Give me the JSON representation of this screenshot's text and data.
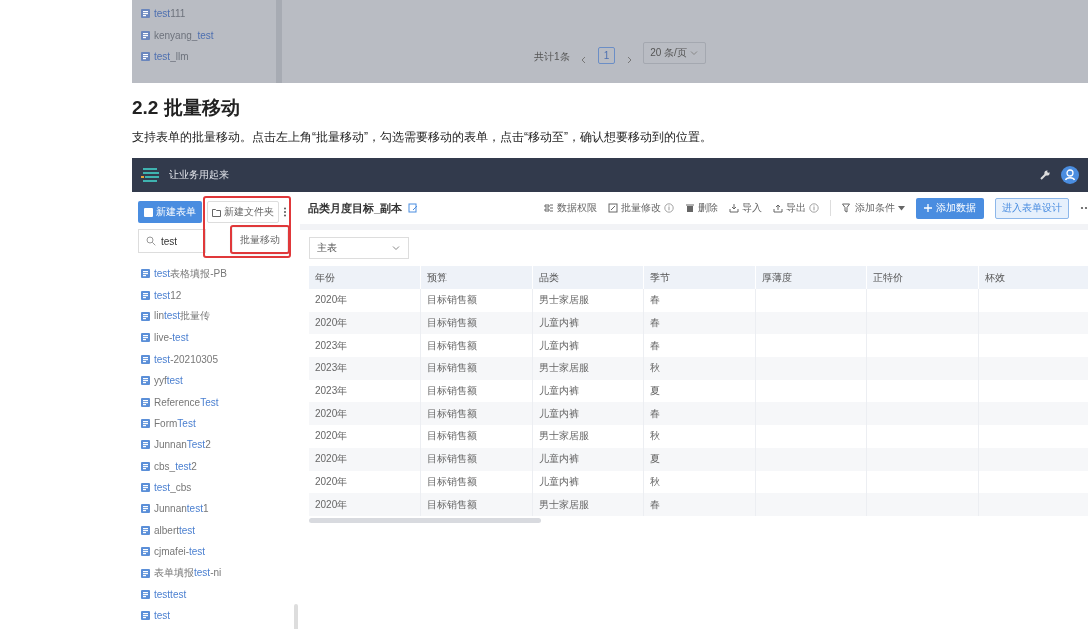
{
  "prior_screenshot": {
    "sidebar_items": [
      {
        "parts": [
          {
            "text": "test",
            "match": true
          },
          {
            "text": "111",
            "match": false
          }
        ]
      },
      {
        "parts": [
          {
            "text": "kenyang_",
            "match": false
          },
          {
            "text": "test",
            "match": true
          }
        ]
      },
      {
        "parts": [
          {
            "text": "test",
            "match": true
          },
          {
            "text": "_llm",
            "match": false
          }
        ]
      }
    ],
    "pagination": {
      "total": "共计1条",
      "page": "1",
      "page_size": "20 条/页"
    }
  },
  "section": {
    "heading": "2.2 批量移动",
    "body": "支持表单的批量移动。点击左上角“批量移动”，勾选需要移动的表单，点击“移动至”，确认想要移动到的位置。"
  },
  "app": {
    "brand": "让业务用起来",
    "sidebar": {
      "new_form": "新建表单",
      "new_folder": "新建文件夹",
      "menu": [
        "批量移动"
      ],
      "search": {
        "value": "test"
      },
      "items": [
        {
          "parts": [
            {
              "text": "test",
              "match": true
            },
            {
              "text": "表格填报-PB",
              "match": false
            }
          ]
        },
        {
          "parts": [
            {
              "text": "test",
              "match": true
            },
            {
              "text": "12",
              "match": false
            }
          ]
        },
        {
          "parts": [
            {
              "text": "lin",
              "match": false
            },
            {
              "text": "test",
              "match": true
            },
            {
              "text": "批量传",
              "match": false
            }
          ]
        },
        {
          "parts": [
            {
              "text": "live-",
              "match": false
            },
            {
              "text": "test",
              "match": true
            }
          ]
        },
        {
          "parts": [
            {
              "text": "test",
              "match": true
            },
            {
              "text": "-20210305",
              "match": false
            }
          ]
        },
        {
          "parts": [
            {
              "text": "yyf",
              "match": false
            },
            {
              "text": "test",
              "match": true
            }
          ]
        },
        {
          "parts": [
            {
              "text": "Reference",
              "match": false
            },
            {
              "text": "Test",
              "match": true
            }
          ]
        },
        {
          "parts": [
            {
              "text": "Form",
              "match": false
            },
            {
              "text": "Test",
              "match": true
            }
          ]
        },
        {
          "parts": [
            {
              "text": "Junnan",
              "match": false
            },
            {
              "text": "Test",
              "match": true
            },
            {
              "text": "2",
              "match": false
            }
          ]
        },
        {
          "parts": [
            {
              "text": "cbs_",
              "match": false
            },
            {
              "text": "test",
              "match": true
            },
            {
              "text": "2",
              "match": false
            }
          ]
        },
        {
          "parts": [
            {
              "text": "test",
              "match": true
            },
            {
              "text": "_cbs",
              "match": false
            }
          ]
        },
        {
          "parts": [
            {
              "text": "Junnan",
              "match": false
            },
            {
              "text": "test",
              "match": true
            },
            {
              "text": "1",
              "match": false
            }
          ]
        },
        {
          "parts": [
            {
              "text": "albert",
              "match": false
            },
            {
              "text": "test",
              "match": true
            }
          ]
        },
        {
          "parts": [
            {
              "text": "cjmafei-",
              "match": false
            },
            {
              "text": "test",
              "match": true
            }
          ]
        },
        {
          "parts": [
            {
              "text": "表单填报",
              "match": false
            },
            {
              "text": "test",
              "match": true
            },
            {
              "text": "-ni",
              "match": false
            }
          ]
        },
        {
          "parts": [
            {
              "text": "testtest",
              "match": true
            }
          ]
        },
        {
          "parts": [
            {
              "text": "test",
              "match": true
            }
          ]
        }
      ]
    },
    "title": "品类月度目标_副本",
    "toolbar": [
      {
        "label": "数据权限",
        "has_info": false
      },
      {
        "label": "批量修改",
        "has_info": true
      },
      {
        "label": "删除",
        "has_info": false
      },
      {
        "label": "导入",
        "has_info": false
      },
      {
        "label": "导出",
        "has_info": true
      }
    ],
    "filter": "添加条件",
    "add_data": "添加数据",
    "design": "进入表单设计",
    "sheet_select": "主表",
    "table": {
      "columns": [
        "年份",
        "预算",
        "品类",
        "季节",
        "厚薄度",
        "正特价",
        "杯效"
      ],
      "rows": [
        [
          "2020年",
          "目标销售额",
          "男士家居服",
          "春"
        ],
        [
          "2020年",
          "目标销售额",
          "儿童内裤",
          "春"
        ],
        [
          "2023年",
          "目标销售额",
          "儿童内裤",
          "春"
        ],
        [
          "2023年",
          "目标销售额",
          "男士家居服",
          "秋"
        ],
        [
          "2023年",
          "目标销售额",
          "儿童内裤",
          "夏"
        ],
        [
          "2020年",
          "目标销售额",
          "儿童内裤",
          "春"
        ],
        [
          "2020年",
          "目标销售额",
          "男士家居服",
          "秋"
        ],
        [
          "2020年",
          "目标销售额",
          "儿童内裤",
          "夏"
        ],
        [
          "2020年",
          "目标销售额",
          "儿童内裤",
          "秋"
        ],
        [
          "2020年",
          "目标销售额",
          "男士家居服",
          "春"
        ]
      ]
    }
  }
}
